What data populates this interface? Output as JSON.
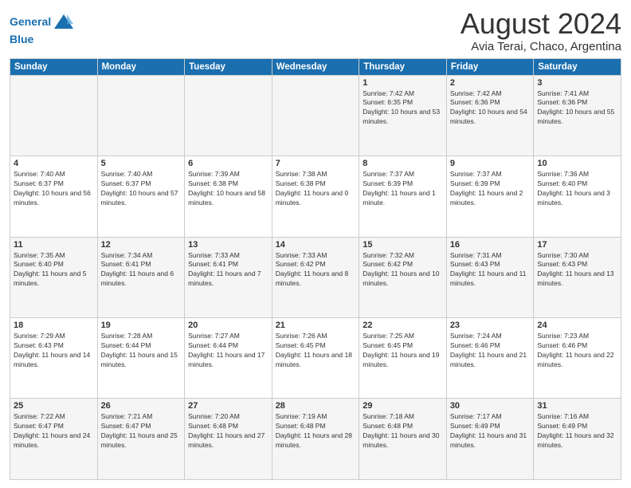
{
  "header": {
    "logo_line1": "General",
    "logo_line2": "Blue",
    "month_title": "August 2024",
    "subtitle": "Avia Terai, Chaco, Argentina"
  },
  "days_of_week": [
    "Sunday",
    "Monday",
    "Tuesday",
    "Wednesday",
    "Thursday",
    "Friday",
    "Saturday"
  ],
  "weeks": [
    [
      {
        "day": "",
        "sunrise": "",
        "sunset": "",
        "daylight": ""
      },
      {
        "day": "",
        "sunrise": "",
        "sunset": "",
        "daylight": ""
      },
      {
        "day": "",
        "sunrise": "",
        "sunset": "",
        "daylight": ""
      },
      {
        "day": "",
        "sunrise": "",
        "sunset": "",
        "daylight": ""
      },
      {
        "day": "1",
        "sunrise": "Sunrise: 7:42 AM",
        "sunset": "Sunset: 6:35 PM",
        "daylight": "Daylight: 10 hours and 53 minutes."
      },
      {
        "day": "2",
        "sunrise": "Sunrise: 7:42 AM",
        "sunset": "Sunset: 6:36 PM",
        "daylight": "Daylight: 10 hours and 54 minutes."
      },
      {
        "day": "3",
        "sunrise": "Sunrise: 7:41 AM",
        "sunset": "Sunset: 6:36 PM",
        "daylight": "Daylight: 10 hours and 55 minutes."
      }
    ],
    [
      {
        "day": "4",
        "sunrise": "Sunrise: 7:40 AM",
        "sunset": "Sunset: 6:37 PM",
        "daylight": "Daylight: 10 hours and 56 minutes."
      },
      {
        "day": "5",
        "sunrise": "Sunrise: 7:40 AM",
        "sunset": "Sunset: 6:37 PM",
        "daylight": "Daylight: 10 hours and 57 minutes."
      },
      {
        "day": "6",
        "sunrise": "Sunrise: 7:39 AM",
        "sunset": "Sunset: 6:38 PM",
        "daylight": "Daylight: 10 hours and 58 minutes."
      },
      {
        "day": "7",
        "sunrise": "Sunrise: 7:38 AM",
        "sunset": "Sunset: 6:38 PM",
        "daylight": "Daylight: 11 hours and 0 minutes."
      },
      {
        "day": "8",
        "sunrise": "Sunrise: 7:37 AM",
        "sunset": "Sunset: 6:39 PM",
        "daylight": "Daylight: 11 hours and 1 minute."
      },
      {
        "day": "9",
        "sunrise": "Sunrise: 7:37 AM",
        "sunset": "Sunset: 6:39 PM",
        "daylight": "Daylight: 11 hours and 2 minutes."
      },
      {
        "day": "10",
        "sunrise": "Sunrise: 7:36 AM",
        "sunset": "Sunset: 6:40 PM",
        "daylight": "Daylight: 11 hours and 3 minutes."
      }
    ],
    [
      {
        "day": "11",
        "sunrise": "Sunrise: 7:35 AM",
        "sunset": "Sunset: 6:40 PM",
        "daylight": "Daylight: 11 hours and 5 minutes."
      },
      {
        "day": "12",
        "sunrise": "Sunrise: 7:34 AM",
        "sunset": "Sunset: 6:41 PM",
        "daylight": "Daylight: 11 hours and 6 minutes."
      },
      {
        "day": "13",
        "sunrise": "Sunrise: 7:33 AM",
        "sunset": "Sunset: 6:41 PM",
        "daylight": "Daylight: 11 hours and 7 minutes."
      },
      {
        "day": "14",
        "sunrise": "Sunrise: 7:33 AM",
        "sunset": "Sunset: 6:42 PM",
        "daylight": "Daylight: 11 hours and 8 minutes."
      },
      {
        "day": "15",
        "sunrise": "Sunrise: 7:32 AM",
        "sunset": "Sunset: 6:42 PM",
        "daylight": "Daylight: 11 hours and 10 minutes."
      },
      {
        "day": "16",
        "sunrise": "Sunrise: 7:31 AM",
        "sunset": "Sunset: 6:43 PM",
        "daylight": "Daylight: 11 hours and 11 minutes."
      },
      {
        "day": "17",
        "sunrise": "Sunrise: 7:30 AM",
        "sunset": "Sunset: 6:43 PM",
        "daylight": "Daylight: 11 hours and 13 minutes."
      }
    ],
    [
      {
        "day": "18",
        "sunrise": "Sunrise: 7:29 AM",
        "sunset": "Sunset: 6:43 PM",
        "daylight": "Daylight: 11 hours and 14 minutes."
      },
      {
        "day": "19",
        "sunrise": "Sunrise: 7:28 AM",
        "sunset": "Sunset: 6:44 PM",
        "daylight": "Daylight: 11 hours and 15 minutes."
      },
      {
        "day": "20",
        "sunrise": "Sunrise: 7:27 AM",
        "sunset": "Sunset: 6:44 PM",
        "daylight": "Daylight: 11 hours and 17 minutes."
      },
      {
        "day": "21",
        "sunrise": "Sunrise: 7:26 AM",
        "sunset": "Sunset: 6:45 PM",
        "daylight": "Daylight: 11 hours and 18 minutes."
      },
      {
        "day": "22",
        "sunrise": "Sunrise: 7:25 AM",
        "sunset": "Sunset: 6:45 PM",
        "daylight": "Daylight: 11 hours and 19 minutes."
      },
      {
        "day": "23",
        "sunrise": "Sunrise: 7:24 AM",
        "sunset": "Sunset: 6:46 PM",
        "daylight": "Daylight: 11 hours and 21 minutes."
      },
      {
        "day": "24",
        "sunrise": "Sunrise: 7:23 AM",
        "sunset": "Sunset: 6:46 PM",
        "daylight": "Daylight: 11 hours and 22 minutes."
      }
    ],
    [
      {
        "day": "25",
        "sunrise": "Sunrise: 7:22 AM",
        "sunset": "Sunset: 6:47 PM",
        "daylight": "Daylight: 11 hours and 24 minutes."
      },
      {
        "day": "26",
        "sunrise": "Sunrise: 7:21 AM",
        "sunset": "Sunset: 6:47 PM",
        "daylight": "Daylight: 11 hours and 25 minutes."
      },
      {
        "day": "27",
        "sunrise": "Sunrise: 7:20 AM",
        "sunset": "Sunset: 6:48 PM",
        "daylight": "Daylight: 11 hours and 27 minutes."
      },
      {
        "day": "28",
        "sunrise": "Sunrise: 7:19 AM",
        "sunset": "Sunset: 6:48 PM",
        "daylight": "Daylight: 11 hours and 28 minutes."
      },
      {
        "day": "29",
        "sunrise": "Sunrise: 7:18 AM",
        "sunset": "Sunset: 6:48 PM",
        "daylight": "Daylight: 11 hours and 30 minutes."
      },
      {
        "day": "30",
        "sunrise": "Sunrise: 7:17 AM",
        "sunset": "Sunset: 6:49 PM",
        "daylight": "Daylight: 11 hours and 31 minutes."
      },
      {
        "day": "31",
        "sunrise": "Sunrise: 7:16 AM",
        "sunset": "Sunset: 6:49 PM",
        "daylight": "Daylight: 11 hours and 32 minutes."
      }
    ]
  ]
}
